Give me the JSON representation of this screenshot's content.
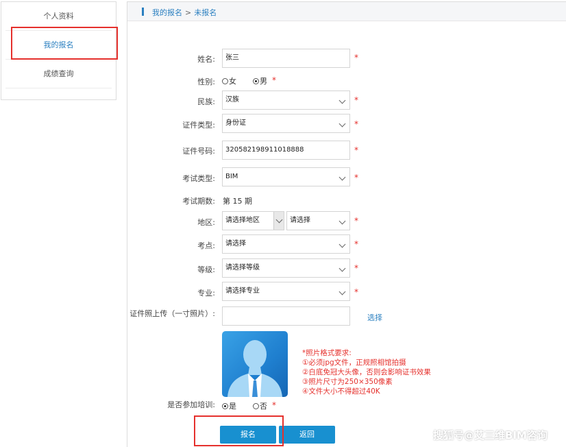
{
  "sidebar": {
    "items": [
      {
        "label": "个人资料"
      },
      {
        "label": "我的报名"
      },
      {
        "label": "成绩查询"
      }
    ]
  },
  "breadcrumb": {
    "parent": "我的报名",
    "separator": ">",
    "current": "未报名"
  },
  "form": {
    "name": {
      "label": "姓名:",
      "value": "张三"
    },
    "gender": {
      "label": "性别:",
      "option_female": "女",
      "option_male": "男",
      "selected": "男"
    },
    "ethnicity": {
      "label": "民族:",
      "value": "汉族"
    },
    "id_type": {
      "label": "证件类型:",
      "value": "身份证"
    },
    "id_number": {
      "label": "证件号码:",
      "value": "320582198911018888"
    },
    "exam_type": {
      "label": "考试类型:",
      "value": "BIM"
    },
    "exam_period": {
      "label": "考试期数:",
      "value": "第 15 期"
    },
    "region": {
      "label": "地区:",
      "value_1": "请选择地区",
      "value_2": "请选择"
    },
    "exam_site": {
      "label": "考点:",
      "value": "请选择"
    },
    "level": {
      "label": "等级:",
      "value": "请选择等级"
    },
    "major": {
      "label": "专业:",
      "value": "请选择专业"
    },
    "photo_upload": {
      "label": "证件照上传（一寸照片）:",
      "select_label": "选择"
    },
    "photo_notes": [
      "*照片格式要求:",
      "①必须jpg文件，正规照相馆拍摄",
      "②白底免冠大头像，否则会影响证书效果",
      "③照片尺寸为250×350像素",
      "④文件大小不得超过40K"
    ],
    "training": {
      "label": "是否参加培训:",
      "option_yes": "是",
      "option_no": "否",
      "selected": "是"
    },
    "required_mark": "*"
  },
  "buttons": {
    "submit": "报名",
    "back": "返回"
  },
  "watermark": "搜狐号@艾三维BIM咨询",
  "colors": {
    "accent": "#1890d0",
    "link": "#2a7fc0",
    "required": "#e5302c"
  }
}
